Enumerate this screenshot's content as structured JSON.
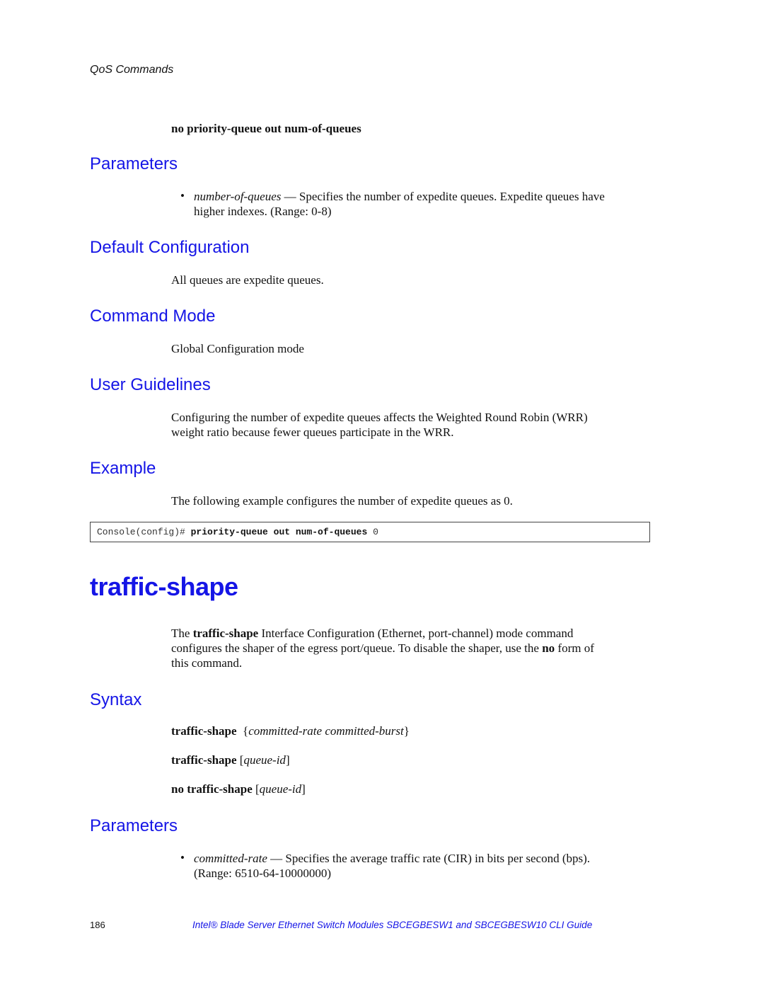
{
  "running_head": "QoS Commands",
  "prev_command": {
    "syntax_no_form": "no priority-queue out num-of-queues",
    "parameters_heading": "Parameters",
    "parameters": [
      {
        "name": "number-of-queues",
        "dash": " — ",
        "description_line1": "Specifies the number of expedite queues. Expedite queues have",
        "description_line2": "higher indexes. (Range: 0-8)"
      }
    ],
    "default_config_heading": "Default Configuration",
    "default_config_text": "All queues are expedite queues.",
    "command_mode_heading": "Command Mode",
    "command_mode_text": "Global Configuration mode",
    "user_guidelines_heading": "User Guidelines",
    "user_guidelines_line1": "Configuring the number of expedite queues affects the Weighted Round Robin (WRR)",
    "user_guidelines_line2": "weight ratio because fewer queues participate in the WRR.",
    "example_heading": "Example",
    "example_text": "The following example configures the number of expedite queues as 0.",
    "example_code": {
      "prompt": "Console(config)# ",
      "command": "priority-queue out num-of-queues",
      "arg": " 0"
    }
  },
  "command": {
    "title": "traffic-shape",
    "intro": {
      "prefix": "The ",
      "cmd": "traffic-shape",
      "line1_rest": " Interface Configuration (Ethernet, port-channel) mode command",
      "line2_pre": "configures the shaper of the egress port/queue. To disable the shaper, use the ",
      "no_word": "no",
      "line2_post": " form of",
      "line3": "this command."
    },
    "syntax_heading": "Syntax",
    "syntax": [
      {
        "cmd": "traffic-shape",
        "open": "  {",
        "args": "committed-rate committed-burst",
        "close": "}"
      },
      {
        "cmd": "traffic-shape",
        "open": " [",
        "args": "queue-id",
        "close": "]"
      },
      {
        "cmd": "no traffic-shape",
        "open": " [",
        "args": "queue-id",
        "close": "]"
      }
    ],
    "parameters_heading": "Parameters",
    "parameters": [
      {
        "name": "committed-rate",
        "dash": " — ",
        "description_line1": "Specifies the average traffic rate (CIR) in bits per second (bps).",
        "description_line2": "(Range: 6510-64-10000000)"
      }
    ]
  },
  "footer": {
    "page_number": "186",
    "book_title": "Intel® Blade Server Ethernet Switch Modules SBCEGBESW1 and SBCEGBESW10 CLI Guide"
  }
}
